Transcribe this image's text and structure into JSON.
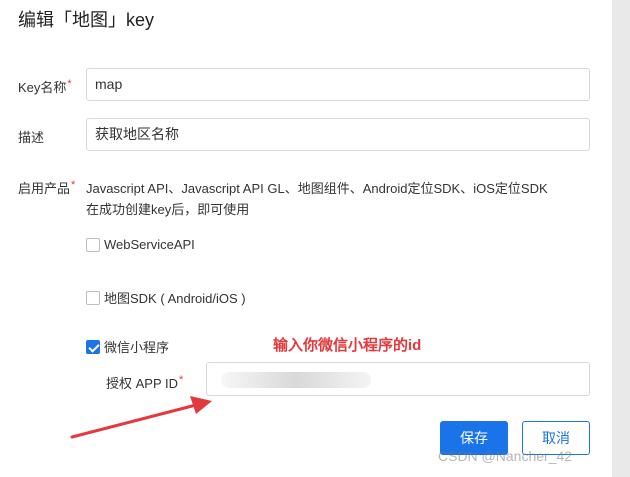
{
  "dialog": {
    "title": "编辑「地图」key"
  },
  "form": {
    "key_name": {
      "label": "Key名称",
      "required_mark": "*",
      "value": "map"
    },
    "description": {
      "label": "描述",
      "value": "获取地区名称"
    },
    "products": {
      "label": "启用产品",
      "required_mark": "*",
      "default_list": "Javascript API、Javascript API GL、地图组件、Android定位SDK、iOS定位SDK",
      "note": "在成功创建key后，即可使用",
      "options": [
        {
          "label": "WebServiceAPI",
          "checked": false
        },
        {
          "label": "地图SDK ( Android/iOS )",
          "checked": false
        },
        {
          "label": "微信小程序",
          "checked": true
        }
      ]
    },
    "app_id": {
      "label": "授权 APP ID",
      "required_mark": "*",
      "value": ""
    }
  },
  "annotation": {
    "text": "输入你微信小程序的id",
    "color": "#e4393c"
  },
  "buttons": {
    "save": "保存",
    "cancel": "取消"
  },
  "watermark": {
    "text": "CSDN @Nancher_42"
  },
  "colors": {
    "primary": "#1a73e8",
    "annotation": "#e4393c"
  }
}
